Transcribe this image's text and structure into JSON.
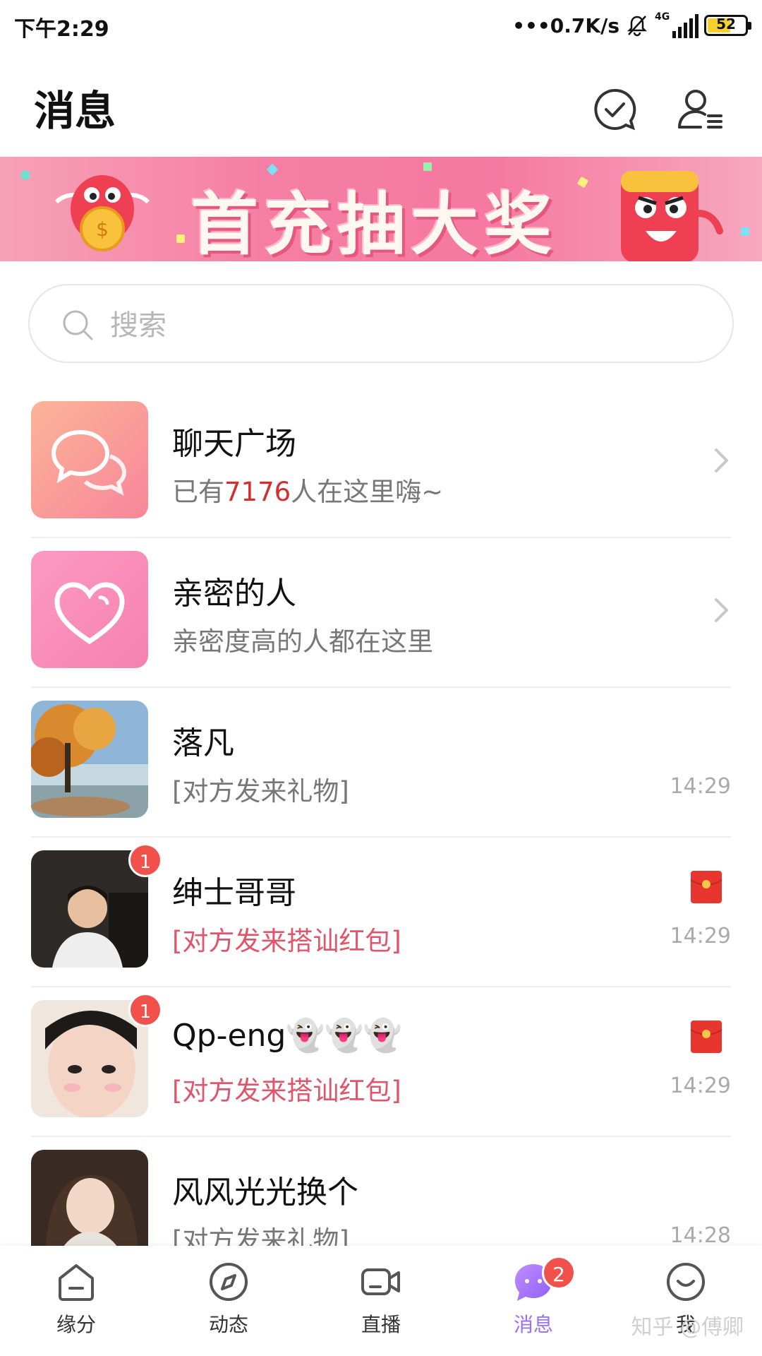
{
  "status_bar": {
    "time": "下午2:29",
    "network_speed": "•••0.7K/s",
    "network_type": "4G",
    "battery": "52"
  },
  "header": {
    "title": "消息",
    "icons": [
      "chat-check-icon",
      "contacts-icon"
    ]
  },
  "banner": {
    "text": "首充抽大奖"
  },
  "search": {
    "placeholder": "搜索"
  },
  "list": [
    {
      "name": "聊天广场",
      "sub_prefix": "已有",
      "sub_highlight": "7176",
      "sub_suffix": "人在这里嗨~",
      "type": "chat-square"
    },
    {
      "name": "亲密的人",
      "sub": "亲密度高的人都在这里",
      "type": "intimate"
    },
    {
      "name": "落凡",
      "sub": "[对方发来礼物]",
      "time": "14:29"
    },
    {
      "name": "绅士哥哥",
      "sub": "[对方发来搭讪红包]",
      "time": "14:29",
      "unread": "1",
      "red_packet": true
    },
    {
      "name": "Qp-eng👻👻👻",
      "sub": "[对方发来搭讪红包]",
      "time": "14:29",
      "unread": "1",
      "red_packet": true
    },
    {
      "name": "风风光光换个",
      "sub": "[对方发来礼物]",
      "time": "14:28"
    }
  ],
  "bottom_nav": [
    {
      "label": "缘分",
      "icon": "home-icon"
    },
    {
      "label": "动态",
      "icon": "compass-icon"
    },
    {
      "label": "直播",
      "icon": "video-icon"
    },
    {
      "label": "消息",
      "icon": "message-icon",
      "badge": "2",
      "active": true
    },
    {
      "label": "我",
      "icon": "smile-icon"
    }
  ],
  "watermark": "知乎 @傅卿",
  "colors": {
    "accent": "#9a6bff",
    "badge": "#f2504a",
    "highlight_red": "#d32f2f",
    "pink_tile": "#f792b8",
    "orange_tile": "#f9a08f"
  }
}
